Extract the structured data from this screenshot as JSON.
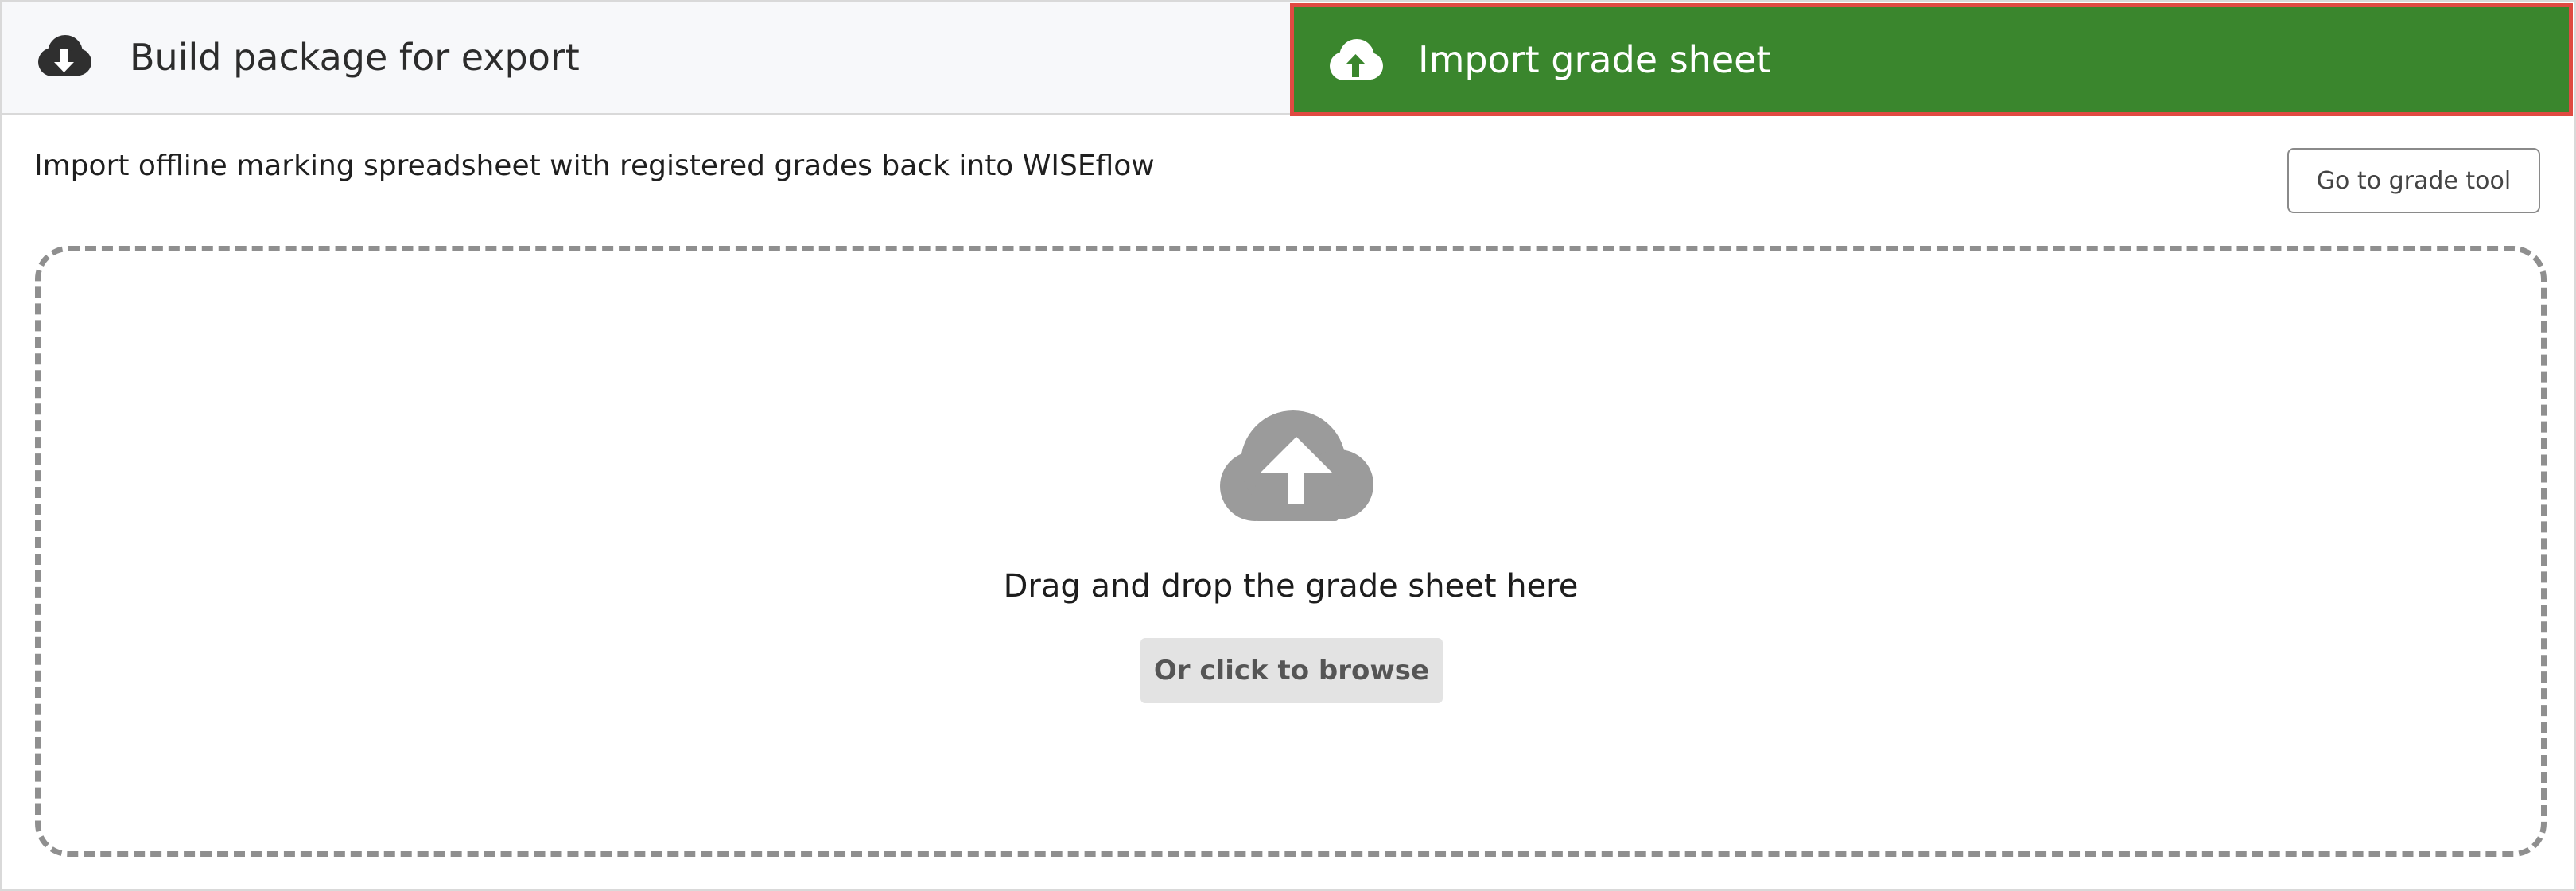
{
  "tabs": {
    "export": {
      "label": "Build package for export",
      "icon": "cloud-download-icon"
    },
    "import": {
      "label": "Import grade sheet",
      "icon": "cloud-upload-icon",
      "active": true
    }
  },
  "main": {
    "description": "Import offline marking spreadsheet with registered grades back into WISEflow",
    "grade_tool_button": "Go to grade tool"
  },
  "dropzone": {
    "icon": "cloud-upload-icon",
    "text": "Drag and drop the grade sheet here",
    "browse_button": "Or click to browse"
  },
  "colors": {
    "active_tab_bg": "#3a862d",
    "active_tab_outline": "#e04a42",
    "dropzone_border": "#8f8f8f",
    "icon_gray": "#9b9b9b"
  }
}
